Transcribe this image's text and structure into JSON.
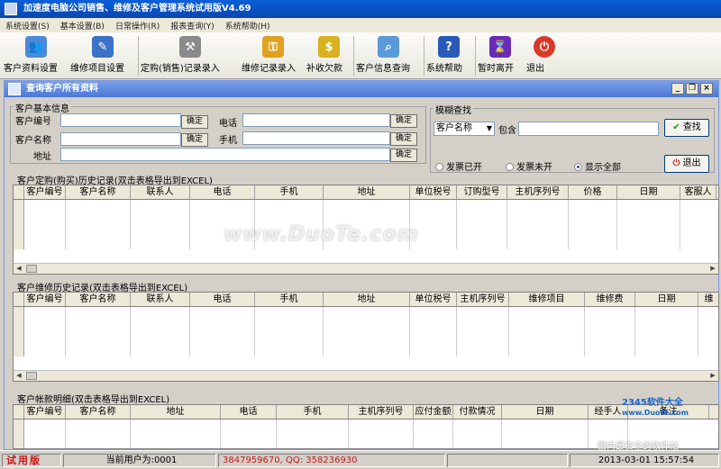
{
  "window": {
    "title": "加速度电脑公司销售、维修及客户管理系统试用版V4.69"
  },
  "menu": [
    "系统设置(S)",
    "基本设置(B)",
    "日常操作(R)",
    "报表查询(Y)",
    "系统帮助(H)"
  ],
  "toolbar": [
    {
      "label": "客户资料设置",
      "icon": "users-gear-icon"
    },
    {
      "label": "维修项目设置",
      "icon": "edit-doc-icon"
    },
    {
      "label": "定购(销售)记录录入",
      "icon": "tools-icon"
    },
    {
      "label": "维修记录录入",
      "icon": "key-icon"
    },
    {
      "label": "补收欠款",
      "icon": "money-icon"
    },
    {
      "label": "客户信息查询",
      "icon": "magnifier-icon"
    },
    {
      "label": "系统帮助",
      "icon": "help-icon"
    },
    {
      "label": "暂时离开",
      "icon": "hourglass-icon"
    },
    {
      "label": "退出",
      "icon": "power-icon"
    }
  ],
  "child_window": {
    "title": "查询客户所有资料"
  },
  "basic_info": {
    "group_title": "客户基本信息",
    "customer_no_label": "客户编号",
    "customer_name_label": "客户名称",
    "address_label": "地址",
    "phone_label": "电话",
    "mobile_label": "手机",
    "confirm_label": "确定"
  },
  "fuzzy": {
    "group_title": "模糊查找",
    "field_select": "客户名称",
    "contains_label": "包含",
    "search_label": "查找",
    "radio_shipped": "发票已开",
    "radio_unshipped": "发票未开",
    "radio_all": "显示全部",
    "exit_label": "退出"
  },
  "orders": {
    "title": "客户定购(购买)历史记录(双击表格导出到EXCEL)",
    "columns": [
      "客户编号",
      "客户名称",
      "联系人",
      "电话",
      "手机",
      "地址",
      "单位税号",
      "订购型号",
      "主机序列号",
      "价格",
      "日期",
      "客服人"
    ]
  },
  "repairs": {
    "title": "客户维修历史记录(双击表格导出到EXCEL)",
    "columns": [
      "客户编号",
      "客户名称",
      "联系人",
      "电话",
      "手机",
      "地址",
      "单位税号",
      "主机序列号",
      "维修项目",
      "维修费",
      "日期",
      "维"
    ]
  },
  "accounts": {
    "title": "客户帐款明细(双击表格导出到EXCEL)",
    "columns": [
      "客户编号",
      "客户名称",
      "地址",
      "电话",
      "手机",
      "主机序列号",
      "应付金额",
      "付款情况",
      "日期",
      "经手人",
      "备注"
    ]
  },
  "status": {
    "trial": "试用版",
    "current_user": "当前用户为:0001",
    "contact": "3847959670, QQ: 358236930",
    "datetime": "2013-03-01  15:57:54"
  },
  "watermark": {
    "main": "www.DuoTe.com",
    "site": "2345软件大全",
    "url": "www.DuoTe.com",
    "slogan": "国内最安全的软件站"
  }
}
